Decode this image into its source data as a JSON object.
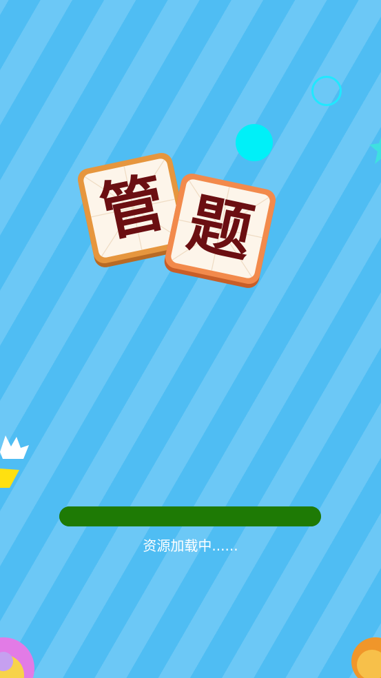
{
  "logo": {
    "tiles": [
      "管",
      "题"
    ]
  },
  "loading": {
    "progress_fraction": 1.0,
    "text": "资源加载中......"
  },
  "colors": {
    "background_stripe_light": "#6cc8f6",
    "background_stripe_dark": "#4fbdf3",
    "progress_bar": "#1e7a05",
    "logo_text": "#6b0f12"
  },
  "decorations": [
    "ring-outline",
    "cyan-dot",
    "star",
    "white-crown-shape",
    "yellow-shape",
    "candy-corner-left",
    "candy-corner-right"
  ]
}
